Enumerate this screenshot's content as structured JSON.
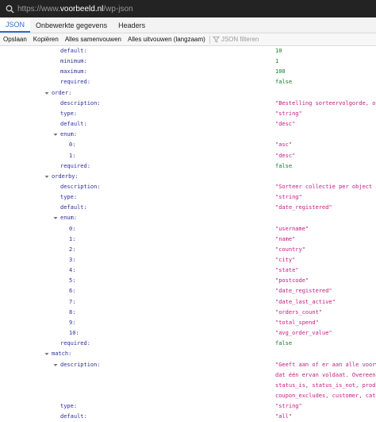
{
  "url": {
    "prefix": "https://www.",
    "host": "voorbeeld.nl",
    "path": "/wp-json"
  },
  "tabs": [
    {
      "label": "JSON",
      "active": true
    },
    {
      "label": "Onbewerkte gegevens",
      "active": false
    },
    {
      "label": "Headers",
      "active": false
    }
  ],
  "toolbar": {
    "save": "Opslaan",
    "copy": "Kopiëren",
    "collapse_all": "Alles samenvouwen",
    "expand_all": "Alles uitvouwen (langzaam)",
    "filter_placeholder": "JSON filteren"
  },
  "colors": {
    "key": "#2d2d9e",
    "string": "#c41a83",
    "number": "#117a2a",
    "active_tab": "#2a6fd6"
  },
  "rows": [
    {
      "key": "default:",
      "value": "10",
      "type": "number",
      "depth": 2
    },
    {
      "key": "minimum:",
      "value": "1",
      "type": "number",
      "depth": 2
    },
    {
      "key": "maximum:",
      "value": "100",
      "type": "number",
      "depth": 2
    },
    {
      "key": "required:",
      "value": "false",
      "type": "bool",
      "depth": 2
    },
    {
      "key": "order:",
      "value": "",
      "type": "object",
      "depth": 1,
      "toggle": true
    },
    {
      "key": "description:",
      "value": "\"Bestelling sorteervolgorde, opl",
      "type": "string",
      "depth": 2
    },
    {
      "key": "type:",
      "value": "\"string\"",
      "type": "string",
      "depth": 2
    },
    {
      "key": "default:",
      "value": "\"desc\"",
      "type": "string",
      "depth": 2
    },
    {
      "key": "enum:",
      "value": "",
      "type": "array",
      "depth": 2,
      "toggle": true
    },
    {
      "key": "0:",
      "value": "\"asc\"",
      "type": "string",
      "depth": 3
    },
    {
      "key": "1:",
      "value": "\"desc\"",
      "type": "string",
      "depth": 3
    },
    {
      "key": "required:",
      "value": "false",
      "type": "bool",
      "depth": 2
    },
    {
      "key": "orderby:",
      "value": "",
      "type": "object",
      "depth": 1,
      "toggle": true
    },
    {
      "key": "description:",
      "value": "\"Sorteer collectie per object at",
      "type": "string",
      "depth": 2
    },
    {
      "key": "type:",
      "value": "\"string\"",
      "type": "string",
      "depth": 2
    },
    {
      "key": "default:",
      "value": "\"date_registered\"",
      "type": "string",
      "depth": 2
    },
    {
      "key": "enum:",
      "value": "",
      "type": "array",
      "depth": 2,
      "toggle": true
    },
    {
      "key": "0:",
      "value": "\"username\"",
      "type": "string",
      "depth": 3
    },
    {
      "key": "1:",
      "value": "\"name\"",
      "type": "string",
      "depth": 3
    },
    {
      "key": "2:",
      "value": "\"country\"",
      "type": "string",
      "depth": 3
    },
    {
      "key": "3:",
      "value": "\"city\"",
      "type": "string",
      "depth": 3
    },
    {
      "key": "4:",
      "value": "\"state\"",
      "type": "string",
      "depth": 3
    },
    {
      "key": "5:",
      "value": "\"postcode\"",
      "type": "string",
      "depth": 3
    },
    {
      "key": "6:",
      "value": "\"date_registered\"",
      "type": "string",
      "depth": 3
    },
    {
      "key": "7:",
      "value": "\"date_last_active\"",
      "type": "string",
      "depth": 3
    },
    {
      "key": "8:",
      "value": "\"orders_count\"",
      "type": "string",
      "depth": 3
    },
    {
      "key": "9:",
      "value": "\"total_spend\"",
      "type": "string",
      "depth": 3
    },
    {
      "key": "10:",
      "value": "\"avg_order_value\"",
      "type": "string",
      "depth": 3
    },
    {
      "key": "required:",
      "value": "false",
      "type": "bool",
      "depth": 2
    },
    {
      "key": "match:",
      "value": "",
      "type": "object",
      "depth": 1,
      "toggle": true
    },
    {
      "key": "description:",
      "value": "\"Geeft aan of er aan alle voorwa",
      "type": "string",
      "depth": 2,
      "toggle": true
    },
    {
      "key": "",
      "value": "dat één ervan voldaat. Overeenk",
      "type": "string",
      "depth": 2
    },
    {
      "key": "",
      "value": "status_is, status_is_not, produc",
      "type": "string",
      "depth": 2
    },
    {
      "key": "",
      "value": "coupon_excludes, customer, categ",
      "type": "string",
      "depth": 2
    },
    {
      "key": "type:",
      "value": "\"string\"",
      "type": "string",
      "depth": 2
    },
    {
      "key": "default:",
      "value": "\"all\"",
      "type": "string",
      "depth": 2
    }
  ]
}
